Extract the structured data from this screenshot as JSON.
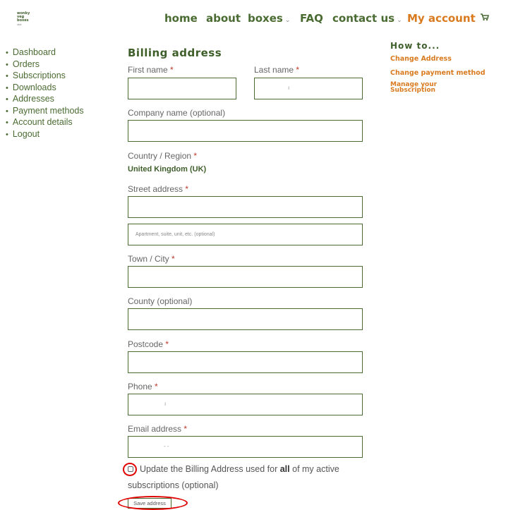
{
  "logo": {
    "line1": "wonky",
    "line2": "veg",
    "line3": "boxes",
    "line4": "club"
  },
  "nav": {
    "home": "home",
    "about": "about",
    "boxes": "boxes",
    "faq": "FAQ",
    "contact": "contact us",
    "account": "My account",
    "chevron": "⌄",
    "cart_icon": "cart-icon"
  },
  "sidebar": {
    "items": [
      "Dashboard",
      "Orders",
      "Subscriptions",
      "Downloads",
      "Addresses",
      "Payment methods",
      "Account details",
      "Logout"
    ]
  },
  "aside": {
    "title": "How to...",
    "links": [
      "Change Address",
      "Change payment method",
      "Manage your",
      "Subscription"
    ]
  },
  "form": {
    "title": "Billing address",
    "required_mark": "*",
    "first_name": {
      "label": "First name",
      "value": ""
    },
    "last_name": {
      "label": "Last name",
      "value": "ı"
    },
    "company": {
      "label": "Company name (optional)",
      "value": ""
    },
    "country": {
      "label": "Country / Region",
      "value": "United Kingdom (UK)"
    },
    "street": {
      "label": "Street address",
      "value": ""
    },
    "apartment": {
      "placeholder": "Apartment, suite, unit, etc. (optional)"
    },
    "town": {
      "label": "Town / City",
      "value": ""
    },
    "county": {
      "label": "County (optional)",
      "value": ""
    },
    "postcode": {
      "label": "Postcode",
      "value": ""
    },
    "phone": {
      "label": "Phone",
      "value": "ı"
    },
    "email": {
      "label": "Email address",
      "value": "- -"
    },
    "update_pre": "Update the Billing Address used for ",
    "update_bold": "all",
    "update_post": " of my active",
    "update_line2": "subscriptions (optional)",
    "save_label": "Save address"
  },
  "colors": {
    "brand_green": "#4a6b32",
    "accent_orange": "#d97a1e",
    "annotation_red": "#e00000"
  }
}
